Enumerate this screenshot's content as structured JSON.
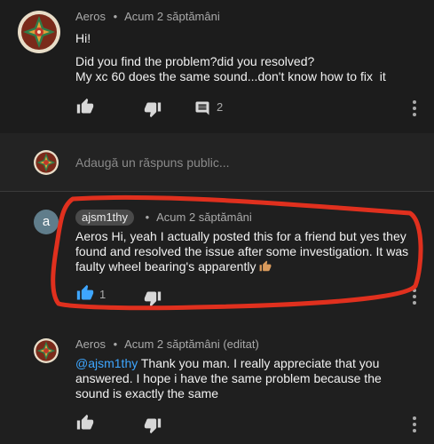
{
  "comment1": {
    "author": "Aeros",
    "time": "Acum 2 săptămâni",
    "greeting": "Hi!",
    "line1": "Did you find the problem?did you resolved?",
    "line2": "My xc 60 does the same sound...don't know how to fix  it",
    "reply_count": "2"
  },
  "reply_box": {
    "placeholder": "Adaugă un răspuns public..."
  },
  "reply1": {
    "avatar_letter": "a",
    "author": "ajsm1thy",
    "time": "Acum 2 săptămâni",
    "line1": "Aeros Hi, yeah I actually posted this for a friend but yes they",
    "line2": "found and resolved the issue after some investigation. It was",
    "line3": "faulty wheel bearing's apparently",
    "like_count": "1"
  },
  "reply2": {
    "author": "Aeros",
    "time": "Acum 2 săptămâni (editat)",
    "mention": "@ajsm1thy",
    "line1": " Thank you man. I really appreciate that you",
    "line2": "answered. I hope i have the same problem because the",
    "line3": "sound is exactly the same"
  },
  "colors": {
    "background": "#1c1c1c",
    "like_active": "#3ea6ff",
    "annotation": "#e0301e"
  },
  "icons": [
    "like-icon",
    "dislike-icon",
    "comment-icon",
    "more-vert-icon",
    "thumbs-up-emoji"
  ]
}
